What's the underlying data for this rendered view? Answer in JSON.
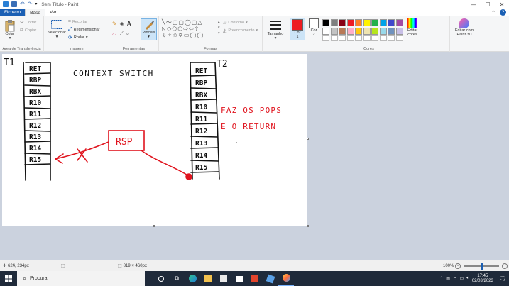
{
  "window": {
    "title": "Sem Título - Paint",
    "minimize": "—",
    "maximize": "☐",
    "close": "✕"
  },
  "tabs": [
    {
      "label": "Ficheiro"
    },
    {
      "label": "Base"
    },
    {
      "label": "Ver"
    }
  ],
  "ribbon": {
    "clipboard": {
      "label": "Área de Transferência",
      "paste": "Colar",
      "cut": "Cortar",
      "copy": "Copiar"
    },
    "image": {
      "label": "Imagem",
      "select": "Selecionar",
      "crop": "Recortar",
      "resize": "Redimensionar",
      "rotate": "Rodar"
    },
    "tools": {
      "label": "Ferramentas",
      "brushes": "Pincéis"
    },
    "shapes": {
      "label": "Formas",
      "outline": "Contorno",
      "fill": "Preenchimento"
    },
    "size": {
      "label": "Tamanho"
    },
    "colors": {
      "label": "Cores",
      "color1": "Cor 1",
      "color1_a": "Cor",
      "color1_b": "1",
      "color2_a": "Cor",
      "color2_b": "2",
      "edit_colors_a": "Editar",
      "edit_colors_b": "cores",
      "paint3d_a": "Editar com",
      "paint3d_b": "Paint 3D",
      "palette": [
        "#000000",
        "#7f7f7f",
        "#880015",
        "#ed1c24",
        "#ff7f27",
        "#fff200",
        "#22b14c",
        "#00a2e8",
        "#3f48cc",
        "#a349a4",
        "#ffffff",
        "#c3c3c3",
        "#b97a57",
        "#ffaec9",
        "#ffc90e",
        "#efe4b0",
        "#b5e61d",
        "#99d9ea",
        "#7092be",
        "#c8bfe7"
      ],
      "active_color": "#ed1c24"
    }
  },
  "drawing": {
    "t1_label": "T1",
    "t2_label": "T2",
    "title": "CONTEXT SWITCH",
    "stack_left": [
      "RET",
      "RBP",
      "RBX",
      "R10",
      "R11",
      "R12",
      "R13",
      "R14",
      "R15"
    ],
    "stack_right": [
      "RET",
      "RBP",
      "RBX",
      "R10",
      "R11",
      "R12",
      "R13",
      "R14",
      "R15"
    ],
    "rsp_label": "RSP",
    "note_line1": "FAZ OS POPS",
    "note_line2": "E O RETURN",
    "ink_color": "#e0141e"
  },
  "status": {
    "cursor_pos": "624, 234px",
    "canvas_size": "819 × 460px",
    "zoom": "100%"
  },
  "taskbar": {
    "search_placeholder": "Procurar",
    "time": "17:45",
    "date": "02/03/2023"
  }
}
